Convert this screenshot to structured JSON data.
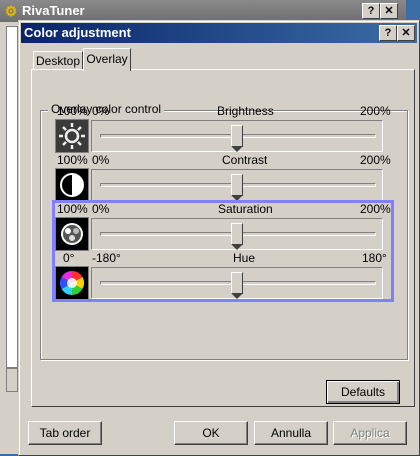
{
  "background_window": {
    "title": "RivaTuner",
    "help_button": "?",
    "close_button": "✕"
  },
  "dialog": {
    "title": "Color adjustment",
    "help_button": "?",
    "close_button": "✕"
  },
  "tabs": [
    {
      "label": "Desktop",
      "active": false
    },
    {
      "label": "Overlay",
      "active": true
    }
  ],
  "group": {
    "label": "Overlay color control"
  },
  "controls": [
    {
      "name": "Brightness",
      "value_label": "100%",
      "min_label": "0%",
      "max_label": "200%",
      "value_fraction": 0.5,
      "icon": "sun-icon"
    },
    {
      "name": "Contrast",
      "value_label": "100%",
      "min_label": "0%",
      "max_label": "200%",
      "value_fraction": 0.5,
      "icon": "contrast-icon"
    },
    {
      "name": "Saturation",
      "value_label": "100%",
      "min_label": "0%",
      "max_label": "200%",
      "value_fraction": 0.5,
      "icon": "saturation-icon"
    },
    {
      "name": "Hue",
      "value_label": "0°",
      "min_label": "-180°",
      "max_label": "180°",
      "value_fraction": 0.5,
      "icon": "color-wheel-icon"
    }
  ],
  "buttons": {
    "defaults": "Defaults",
    "tab_order": "Tab order",
    "ok": "OK",
    "cancel": "Annulla",
    "apply": "Applica"
  },
  "colors": {
    "highlight": "#8080ff",
    "title_bar": "#0a246a",
    "face": "#d4d0c8"
  }
}
